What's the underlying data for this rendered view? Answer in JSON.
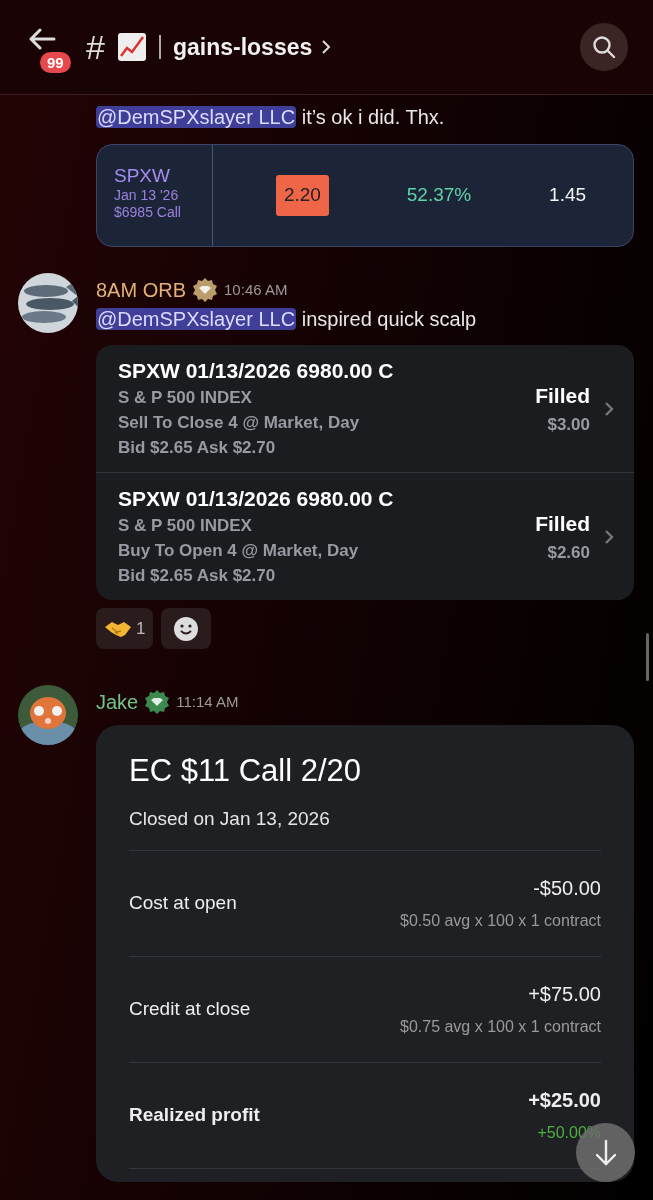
{
  "header": {
    "unread_badge": "99",
    "hash": "#",
    "channel": "gains-losses"
  },
  "messages": [
    {
      "kind": "continuation",
      "mention": "@DemSPXslayer LLC",
      "text": " it’s ok i did. Thx.",
      "quote": {
        "symbol": "SPXW",
        "date": "Jan 13 '26",
        "contract": "$6985 Call",
        "price": "2.20",
        "change": "52.37%",
        "last": "1.45"
      }
    },
    {
      "kind": "message",
      "author": "8AM ORB",
      "color": "#e3b277",
      "time": "10:46 AM",
      "mention": "@DemSPXslayer LLC",
      "text": " inspired quick scalp",
      "orders": [
        {
          "title": "SPXW 01/13/2026 6980.00 C",
          "underlying": "S & P 500 INDEX",
          "action": "Sell To Close 4 @ Market, Day",
          "quote": "Bid $2.65 Ask $2.70",
          "status": "Filled",
          "price": "$3.00"
        },
        {
          "title": "SPXW 01/13/2026 6980.00 C",
          "underlying": "S & P 500 INDEX",
          "action": "Buy To Open 4 @ Market, Day",
          "quote": "Bid $2.65 Ask $2.70",
          "status": "Filled",
          "price": "$2.60"
        }
      ],
      "reactions": [
        {
          "kind": "handshake",
          "count": "1"
        },
        {
          "kind": "add"
        }
      ]
    },
    {
      "kind": "message",
      "author": "Jake",
      "color": "#73c48a",
      "time": "11:14 AM",
      "trade": {
        "title": "EC $11 Call 2/20",
        "subtitle": "Closed on Jan 13, 2026",
        "rows": [
          {
            "label": "Cost at open",
            "value": "-$50.00",
            "detail": "$0.50 avg x 100 x 1 contract",
            "bold": false
          },
          {
            "label": "Credit at close",
            "value": "+$75.00",
            "detail": "$0.75 avg x 100 x 1 contract",
            "bold": false
          },
          {
            "label": "Realized profit",
            "value": "+$25.00",
            "detail": "+50.00%",
            "bold": true
          }
        ]
      }
    }
  ]
}
